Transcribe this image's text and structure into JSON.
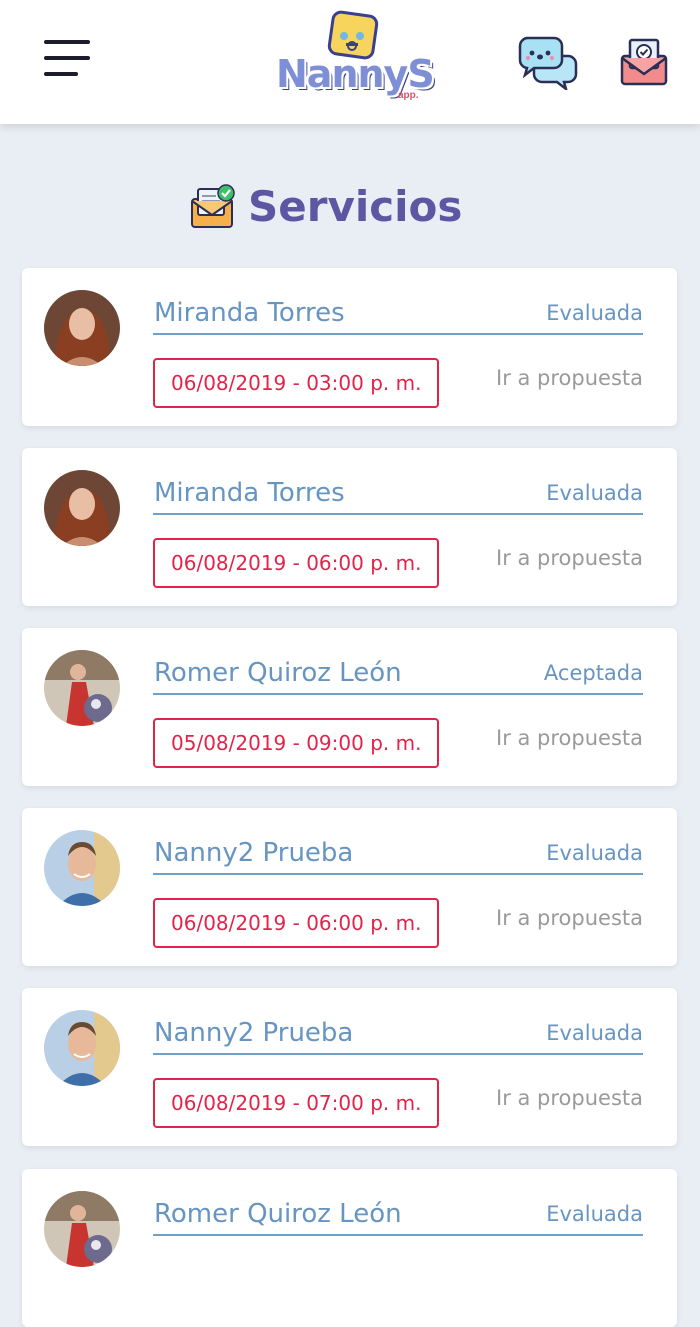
{
  "header": {
    "menu_icon": "hamburger-menu-icon",
    "logo_text": "NannyS",
    "logo_sub": "app.",
    "chat_icon": "chat-bubbles-icon",
    "mail_icon": "mail-check-icon"
  },
  "page": {
    "title": "Servicios",
    "title_icon": "envelope-check-icon"
  },
  "services": [
    {
      "name": "Miranda Torres",
      "status": "Evaluada",
      "date": "06/08/2019 - 03:00 p. m.",
      "link": "Ir a propuesta"
    },
    {
      "name": "Miranda Torres",
      "status": "Evaluada",
      "date": "06/08/2019 - 06:00 p. m.",
      "link": "Ir a propuesta"
    },
    {
      "name": "Romer Quiroz León",
      "status": "Aceptada",
      "date": "05/08/2019 - 09:00 p. m.",
      "link": "Ir a propuesta"
    },
    {
      "name": "Nanny2 Prueba",
      "status": "Evaluada",
      "date": "06/08/2019 - 06:00 p. m.",
      "link": "Ir a propuesta"
    },
    {
      "name": "Nanny2 Prueba",
      "status": "Evaluada",
      "date": "06/08/2019 - 07:00 p. m.",
      "link": "Ir a propuesta"
    },
    {
      "name": "Romer Quiroz León",
      "status": "Evaluada",
      "date": "",
      "link": ""
    }
  ],
  "colors": {
    "accent_blue": "#6795c2",
    "date_red": "#e2244a",
    "title_purple": "#5c57a3",
    "background": "#e9eef4"
  }
}
